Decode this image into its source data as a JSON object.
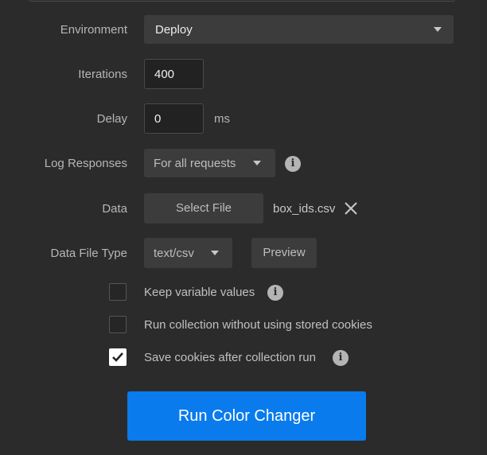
{
  "environment": {
    "label": "Environment",
    "value": "Deploy"
  },
  "iterations": {
    "label": "Iterations",
    "value": "400"
  },
  "delay": {
    "label": "Delay",
    "value": "0",
    "unit": "ms"
  },
  "log_responses": {
    "label": "Log Responses",
    "value": "For all requests"
  },
  "data": {
    "label": "Data",
    "select_file_label": "Select File",
    "file_name": "box_ids.csv"
  },
  "data_file_type": {
    "label": "Data File Type",
    "value": "text/csv",
    "preview_label": "Preview"
  },
  "options": [
    {
      "label": "Keep variable values",
      "checked": false,
      "has_info": true
    },
    {
      "label": "Run collection without using stored cookies",
      "checked": false,
      "has_info": false
    },
    {
      "label": "Save cookies after collection run",
      "checked": true,
      "has_info": true
    }
  ],
  "run_button": {
    "label": "Run Color Changer"
  },
  "colors": {
    "accent": "#097bed",
    "background": "#2b2b2b",
    "control": "#3c3c3c"
  },
  "icons": {
    "info": "info-icon",
    "close": "close-icon",
    "check": "check-icon",
    "caret": "chevron-down-icon"
  }
}
